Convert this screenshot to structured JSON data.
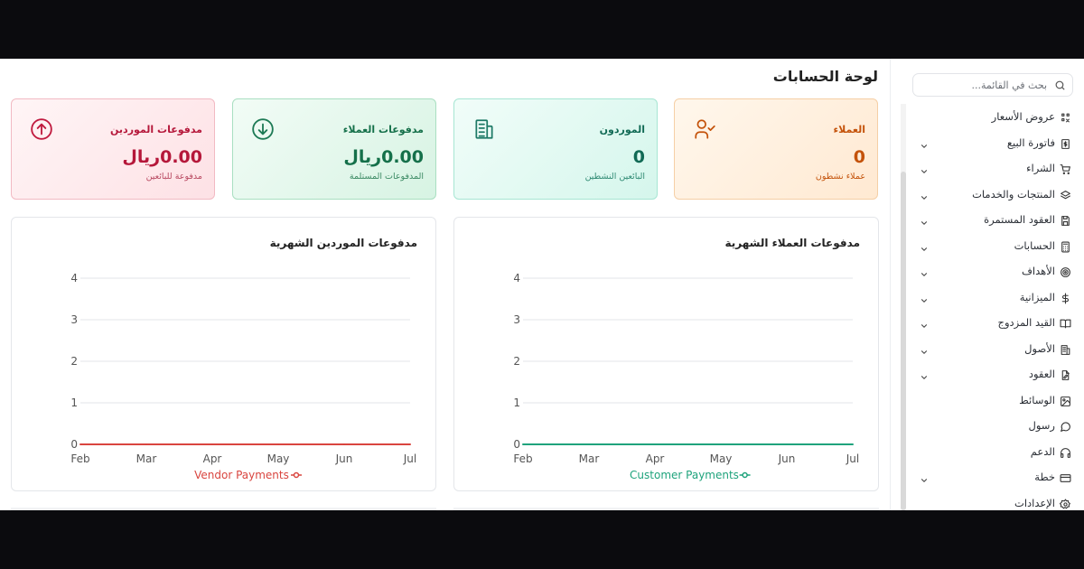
{
  "page_title": "لوحة الحسابات",
  "search": {
    "placeholder": "بحث في القائمة..."
  },
  "sidebar": {
    "items": [
      {
        "label": "عروض الأسعار",
        "icon": "quote-icon",
        "expandable": false
      },
      {
        "label": "فاتورة البيع",
        "icon": "invoice-icon",
        "expandable": true
      },
      {
        "label": "الشراء",
        "icon": "cart-icon",
        "expandable": true
      },
      {
        "label": "المنتجات والخدمات",
        "icon": "layers-icon",
        "expandable": true
      },
      {
        "label": "العقود المستمرة",
        "icon": "save-icon",
        "expandable": true
      },
      {
        "label": "الحسابات",
        "icon": "calculator-icon",
        "expandable": true
      },
      {
        "label": "الأهداف",
        "icon": "target-icon",
        "expandable": true
      },
      {
        "label": "الميزانية",
        "icon": "dollar-icon",
        "expandable": true
      },
      {
        "label": "القيد المزدوج",
        "icon": "book-icon",
        "expandable": true
      },
      {
        "label": "الأصول",
        "icon": "building-icon",
        "expandable": true
      },
      {
        "label": "العقود",
        "icon": "file-edit-icon",
        "expandable": true
      },
      {
        "label": "الوسائط",
        "icon": "image-icon",
        "expandable": false
      },
      {
        "label": "رسول",
        "icon": "message-icon",
        "expandable": false
      },
      {
        "label": "الدعم",
        "icon": "headphones-icon",
        "expandable": false
      },
      {
        "label": "خطة",
        "icon": "card-icon",
        "expandable": true
      },
      {
        "label": "الإعدادات",
        "icon": "settings-icon",
        "expandable": false
      }
    ]
  },
  "cards": {
    "customers": {
      "title": "العملاء",
      "value": "0",
      "subtitle": "عملاء نشطون",
      "icon": "user-check-icon"
    },
    "vendors": {
      "title": "الموردون",
      "value": "0",
      "subtitle": "البائعين النشطين",
      "icon": "building-icon"
    },
    "customer_payments": {
      "title": "مدفوعات العملاء",
      "value": "0.00ريال",
      "subtitle": "المدفوعات المستلمة",
      "icon": "arrow-down-circle-icon"
    },
    "vendor_payments": {
      "title": "مدفوعات الموردين",
      "value": "0.00ريال",
      "subtitle": "مدفوعة للبائعين",
      "icon": "arrow-up-circle-icon"
    }
  },
  "colors": {
    "customer_series": "#1fa37c",
    "vendor_series": "#d9453f"
  },
  "chart_data": [
    {
      "type": "line",
      "title": "مدفوعات العملاء الشهرية",
      "categories": [
        "Feb",
        "Mar",
        "Apr",
        "May",
        "Jun",
        "Jul"
      ],
      "series": [
        {
          "name": "Customer Payments",
          "values": [
            0,
            0,
            0,
            0,
            0,
            0
          ],
          "color": "#1fa37c"
        }
      ],
      "ylim": [
        0,
        4
      ],
      "yticks": [
        "0",
        "1",
        "2",
        "3",
        "4"
      ],
      "grid": true,
      "legend": "bottom"
    },
    {
      "type": "line",
      "title": "مدفوعات الموردين الشهرية",
      "categories": [
        "Feb",
        "Mar",
        "Apr",
        "May",
        "Jun",
        "Jul"
      ],
      "series": [
        {
          "name": "Vendor Payments",
          "values": [
            0,
            0,
            0,
            0,
            0,
            0
          ],
          "color": "#d9453f"
        }
      ],
      "ylim": [
        0,
        4
      ],
      "yticks": [
        "0",
        "1",
        "2",
        "3",
        "4"
      ],
      "grid": true,
      "legend": "bottom"
    }
  ]
}
